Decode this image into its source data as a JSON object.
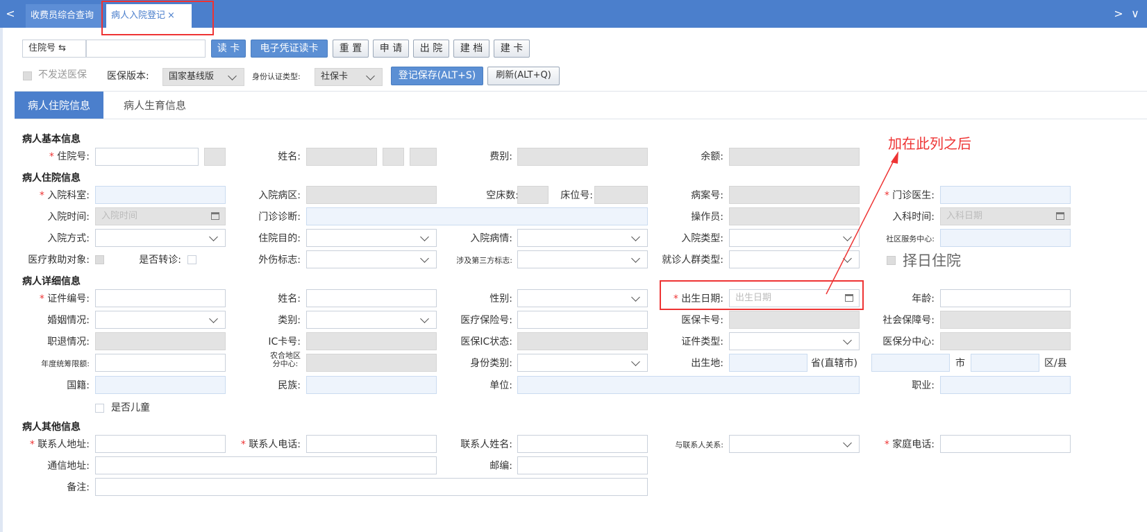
{
  "tabs": {
    "nav_left": "<",
    "nav_right": "> ∨",
    "tab1": "收费员综合查询",
    "tab2": "病人入院登记",
    "tab2_close": "×"
  },
  "toolbar": {
    "search_type": "住院号 ⇆",
    "read_card": "读 卡",
    "e_card": "电子凭证读卡",
    "reset": "重 置",
    "apply": "申 请",
    "discharge": "出 院",
    "archive": "建 档",
    "build_card": "建 卡",
    "no_send_label": "不发送医保",
    "insurance_version_label": "医保版本:",
    "insurance_version_value": "国家基线版",
    "id_type_label": "身份认证类型:",
    "id_type_value": "社保卡",
    "save": "登记保存(ALT+S)",
    "refresh": "刷新(ALT+Q)"
  },
  "pagetabs": {
    "inpatient": "病人住院信息",
    "birth": "病人生育信息"
  },
  "annotation": "加在此列之后",
  "sections": {
    "basic": "病人基本信息",
    "hospital": "病人住院信息",
    "detail": "病人详细信息",
    "other": "病人其他信息"
  },
  "fields": {
    "inpatient_no": "住院号:",
    "name": "姓名:",
    "fee_type": "费别:",
    "balance": "余额:",
    "admit_dept": "入院科室:",
    "admit_ward": "入院病区:",
    "empty_beds": "空床数:",
    "bed_no": "床位号:",
    "case_no": "病案号:",
    "clinic_doctor": "门诊医生:",
    "admit_time": "入院时间:",
    "admit_time_ph": "入院时间",
    "clinic_diag": "门诊诊断:",
    "operator": "操作员:",
    "dept_time": "入科时间:",
    "dept_time_ph": "入科日期",
    "admit_method": "入院方式:",
    "admit_purpose": "住院目的:",
    "admit_condition": "入院病情:",
    "admit_type": "入院类型:",
    "community_center": "社区服务中心:",
    "aid_target": "医疗救助对象:",
    "transfer": "是否转诊:",
    "injury_flag": "外伤标志:",
    "third_party": "涉及第三方标志:",
    "crowd_type": "就诊人群类型:",
    "select_day": "择日住院",
    "id_no": "证件编号:",
    "name2": "姓名:",
    "gender": "性别:",
    "birth_date": "出生日期:",
    "birth_date_ph": "出生日期",
    "age": "年龄:",
    "marital": "婚姻情况:",
    "category": "类别:",
    "insurance_no": "医疗保险号:",
    "insurance_card": "医保卡号:",
    "social_security": "社会保障号:",
    "retire": "职退情况:",
    "ic_card": "IC卡号:",
    "ic_status": "医保IC状态:",
    "id_type": "证件类型:",
    "insurance_center": "医保分中心:",
    "annual_limit": "年度统筹限额:",
    "rural_center_a": "农合地区",
    "rural_center_b": "分中心:",
    "identity_type": "身份类别:",
    "birthplace": "出生地:",
    "province": "省(直辖市)",
    "city": "市",
    "district": "区/县",
    "nationality": "国籍:",
    "ethnicity": "民族:",
    "employer": "单位:",
    "occupation": "职业:",
    "is_child": "是否儿童",
    "contact_addr": "联系人地址:",
    "contact_phone": "联系人电话:",
    "contact_name": "联系人姓名:",
    "contact_rel": "与联系人关系:",
    "home_phone": "家庭电话:",
    "mail_addr": "通信地址:",
    "postcode": "邮编:",
    "remark": "备注:"
  }
}
